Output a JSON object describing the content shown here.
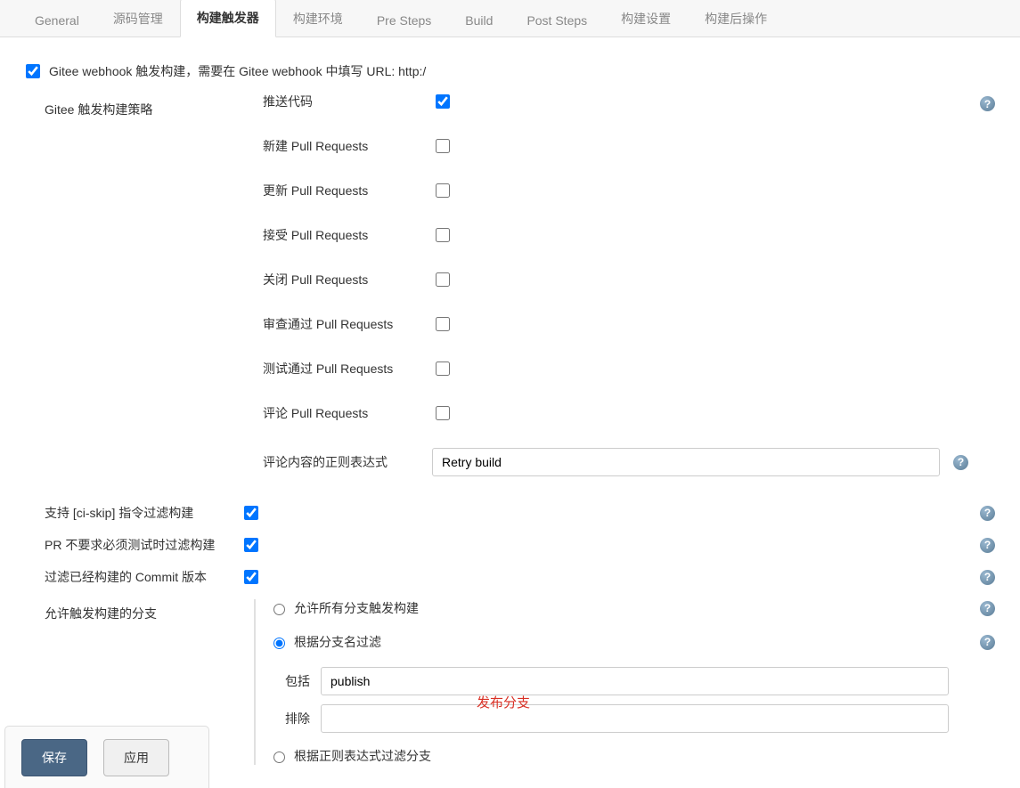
{
  "tabs": {
    "general": "General",
    "scm": "源码管理",
    "trigger": "构建触发器",
    "env": "构建环境",
    "pre": "Pre Steps",
    "build": "Build",
    "post": "Post Steps",
    "settings": "构建设置",
    "postbuild": "构建后操作"
  },
  "webhook": {
    "label": "Gitee webhook 触发构建，需要在 Gitee webhook 中填写 URL: http:/"
  },
  "strategy": {
    "title": "Gitee 触发构建策略",
    "push": "推送代码",
    "new_pr": "新建 Pull Requests",
    "update_pr": "更新 Pull Requests",
    "accept_pr": "接受 Pull Requests",
    "close_pr": "关闭 Pull Requests",
    "review_pr": "审查通过 Pull Requests",
    "test_pr": "测试通过 Pull Requests",
    "comment_pr": "评论 Pull Requests",
    "regex_label": "评论内容的正则表达式",
    "regex_value": "Retry build"
  },
  "options": {
    "ci_skip": "支持 [ci-skip] 指令过滤构建",
    "pr_no_test": "PR 不要求必须测试时过滤构建",
    "filter_built": "过滤已经构建的 Commit 版本"
  },
  "branch": {
    "title": "允许触发构建的分支",
    "allow_all": "允许所有分支触发构建",
    "by_name": "根据分支名过滤",
    "include_label": "包括",
    "include_value": "publish",
    "exclude_label": "排除",
    "exclude_value": "",
    "by_regex": "根据正则表达式过滤分支",
    "publish_note": "发布分支"
  },
  "footer": {
    "save": "保存",
    "apply": "应用"
  }
}
